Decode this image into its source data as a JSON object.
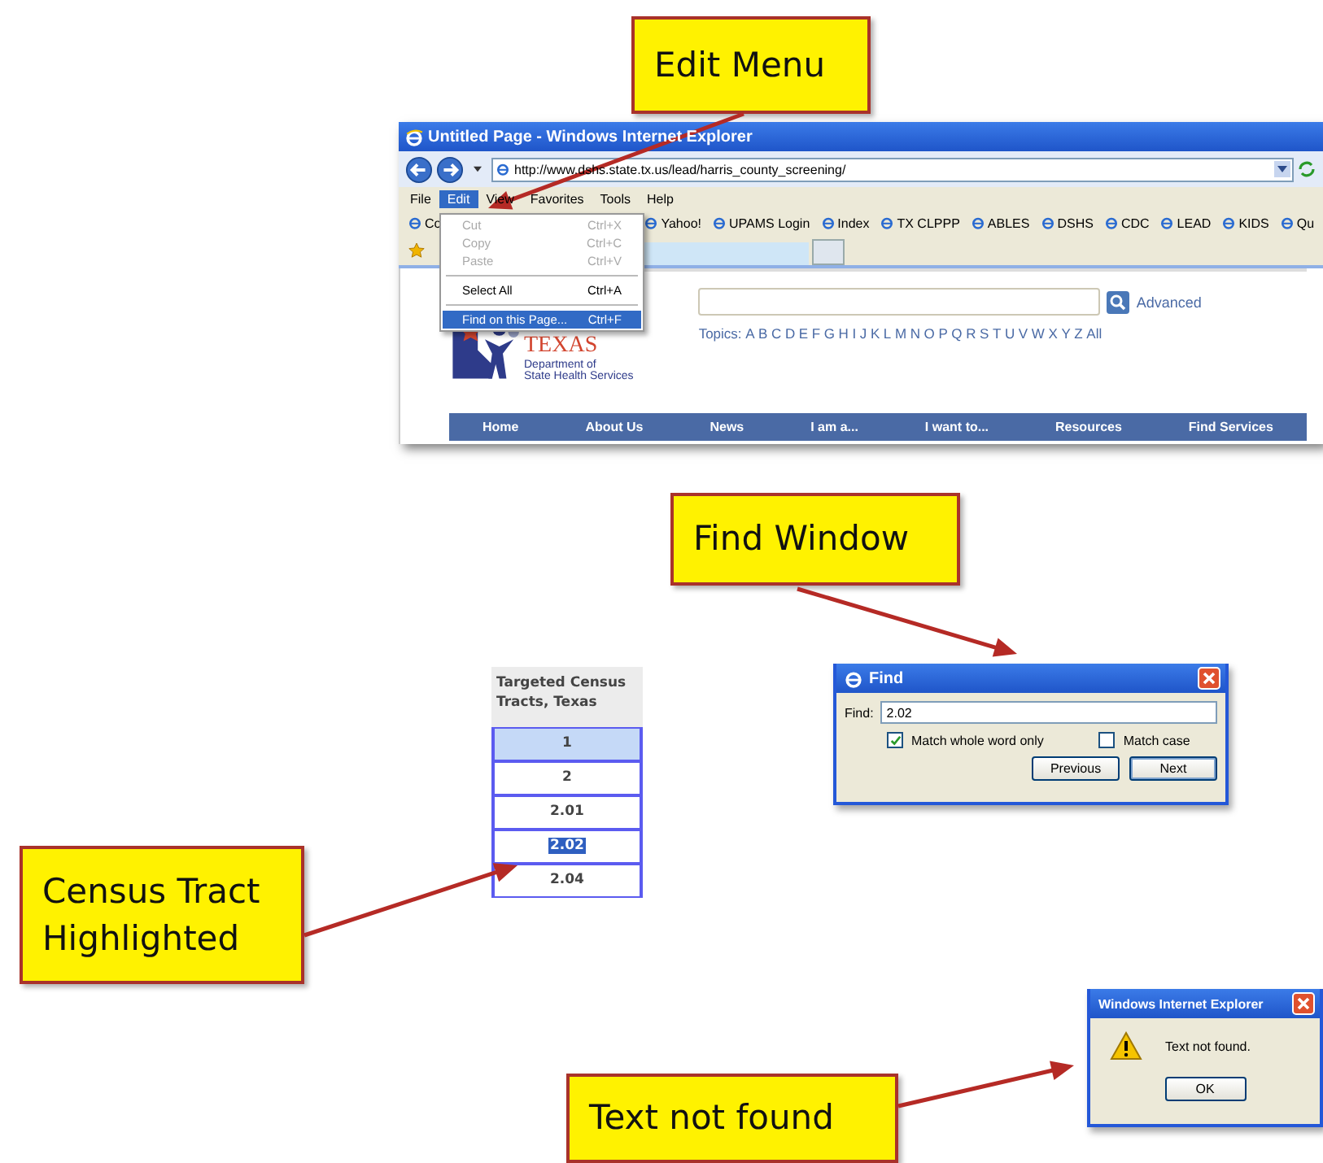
{
  "callouts": [
    {
      "text": "Edit Menu"
    },
    {
      "text": "Find Window"
    },
    {
      "text": "Census Tract Highlighted"
    },
    {
      "text": "Text not found"
    }
  ],
  "browser": {
    "title": "Untitled Page - Windows Internet Explorer",
    "address": "http://www.dshs.state.tx.us/lead/harris_county_screening/",
    "menu": [
      {
        "label": "File",
        "selected": false
      },
      {
        "label": "Edit",
        "selected": true
      },
      {
        "label": "View",
        "selected": false
      },
      {
        "label": "Favorites",
        "selected": false
      },
      {
        "label": "Tools",
        "selected": false
      },
      {
        "label": "Help",
        "selected": false
      }
    ],
    "links": [
      "Co",
      "Yahoo!",
      "UPAMS Login",
      "Index",
      "TX CLPPP",
      "ABLES",
      "DSHS",
      "CDC",
      "LEAD",
      "KIDS",
      "Qu"
    ],
    "edit_menu": [
      {
        "kind": "item",
        "label": "Cut",
        "shortcut": "Ctrl+X",
        "disabled": true,
        "selected": false
      },
      {
        "kind": "item",
        "label": "Copy",
        "shortcut": "Ctrl+C",
        "disabled": true,
        "selected": false
      },
      {
        "kind": "item",
        "label": "Paste",
        "shortcut": "Ctrl+V",
        "disabled": true,
        "selected": false
      },
      {
        "kind": "separator"
      },
      {
        "kind": "item",
        "label": "Select All",
        "shortcut": "Ctrl+A",
        "disabled": false,
        "selected": false
      },
      {
        "kind": "separator"
      },
      {
        "kind": "item",
        "label": "Find on this Page...",
        "shortcut": "Ctrl+F",
        "disabled": false,
        "selected": true
      }
    ],
    "page": {
      "logo_title": "TEXAS",
      "logo_line_1": "Department of",
      "logo_line_2": "State Health Services",
      "advanced": "Advanced",
      "topics_label": "Topics:",
      "topics": [
        "A",
        "B",
        "C",
        "D",
        "E",
        "F",
        "G",
        "H",
        "I",
        "J",
        "K",
        "L",
        "M",
        "N",
        "O",
        "P",
        "Q",
        "R",
        "S",
        "T",
        "U",
        "V",
        "W",
        "X",
        "Y",
        "Z",
        "All"
      ],
      "nav": [
        "Home",
        "About Us",
        "News",
        "I am a...",
        "I want to...",
        "Resources",
        "Find Services"
      ]
    }
  },
  "tract_table": {
    "header": "Targeted Census Tracts, Texas",
    "rows": [
      {
        "value": "1",
        "selected": true,
        "highlighted": false
      },
      {
        "value": "2",
        "selected": false,
        "highlighted": false
      },
      {
        "value": "2.01",
        "selected": false,
        "highlighted": false
      },
      {
        "value": "2.02",
        "selected": false,
        "highlighted": true
      },
      {
        "value": "2.04",
        "selected": false,
        "highlighted": false
      }
    ]
  },
  "find_dialog": {
    "title": "Find",
    "field_label": "Find:",
    "value": "2.02",
    "options": [
      {
        "label": "Match whole word only",
        "checked": true
      },
      {
        "label": "Match case",
        "checked": false
      }
    ],
    "buttons": [
      "Previous",
      "Next"
    ]
  },
  "alert": {
    "title": "Windows Internet Explorer",
    "message": "Text not found.",
    "button": "OK"
  }
}
